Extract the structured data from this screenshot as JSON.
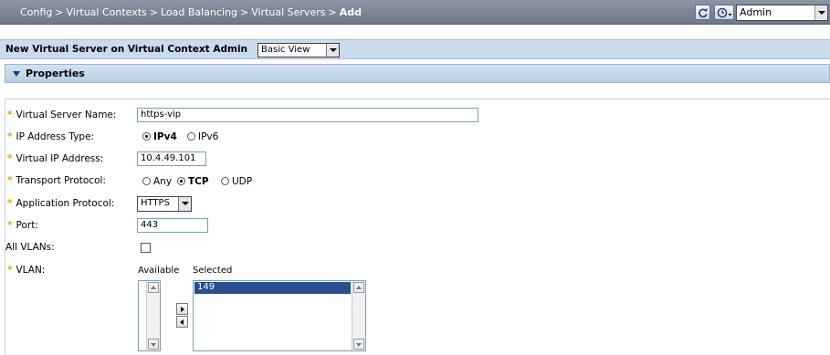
{
  "breadcrumb": {
    "items": [
      "Config",
      "Virtual Contexts",
      "Load Balancing",
      "Virtual Servers"
    ],
    "current": "Add",
    "separator": ">"
  },
  "toolbar": {
    "refresh_icon": "refresh-icon",
    "history_icon": "clock-icon",
    "context_value": "Admin"
  },
  "header": {
    "title": "New Virtual Server on Virtual Context Admin",
    "view_value": "Basic View"
  },
  "section": {
    "title": "Properties"
  },
  "form": {
    "name_label": "Virtual Server Name:",
    "name_value": "https-vip",
    "ip_type_label": "IP Address Type:",
    "ip_type_options": [
      "IPv4",
      "IPv6"
    ],
    "ip_type_selected": "IPv4",
    "vip_label": "Virtual IP Address:",
    "vip_value": "10.4.49.101",
    "transport_label": "Transport Protocol:",
    "transport_options": [
      "Any",
      "TCP",
      "UDP"
    ],
    "transport_selected": "TCP",
    "app_protocol_label": "Application Protocol:",
    "app_protocol_value": "HTTPS",
    "port_label": "Port:",
    "port_value": "443",
    "all_vlans_label": "All VLANs:",
    "all_vlans_checked": false,
    "vlan_label": "VLAN:",
    "available_label": "Available",
    "selected_label": "Selected",
    "available_items": [],
    "selected_items": [
      "149"
    ]
  },
  "colors": {
    "topbar": "#7f8896",
    "titlebar": "#c9dbed",
    "required": "#e8a100",
    "selection": "#2a4d8f"
  }
}
